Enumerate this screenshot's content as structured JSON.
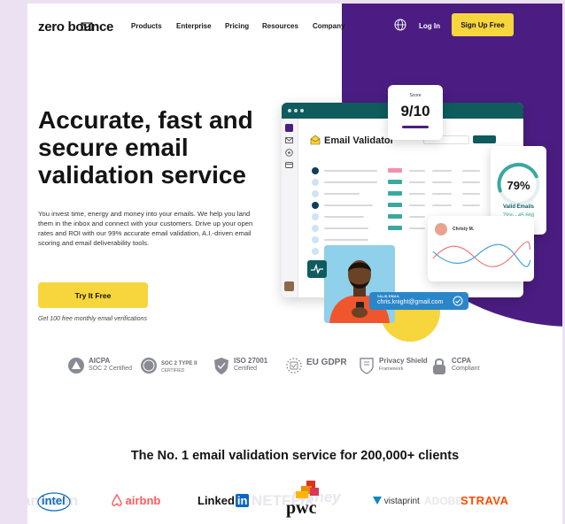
{
  "nav": {
    "logo": "zero bounce",
    "links": [
      "Products",
      "Enterprise",
      "Pricing",
      "Resources",
      "Company"
    ],
    "login": "Log In",
    "signup": "Sign Up Free"
  },
  "hero": {
    "headline": "Accurate, fast and secure email validation service",
    "lead": "You invest time, energy and money into your emails. We help you land them in the inbox and connect with your customers. Drive up your open rates and ROI with our 99% accurate email validation, A.I.-driven email scoring and email deliverability tools.",
    "cta": "Try It Free",
    "cta_note": "Get 100 free monthly email verifications"
  },
  "mock": {
    "title": "Email Validator",
    "score_label": "Score",
    "score_value": "9/10",
    "valid_pct": "79%",
    "valid_pct_value": 79,
    "valid_label": "Valid Emails",
    "valid_count": "79% - 45,668",
    "person_name": "Christy M.",
    "email_label": "VALID EMAIL",
    "email": "chris.knight@gmail.com"
  },
  "certs": [
    {
      "name": "AICPA",
      "sub": "SOC 2 Certified"
    },
    {
      "name": "SOC 2 TYPE II",
      "sub": "CERTIFIED"
    },
    {
      "name": "ISO 27001",
      "sub": "Certified"
    },
    {
      "name": "EU GDPR",
      "sub": ""
    },
    {
      "name": "Privacy Shield",
      "sub": "Framework"
    },
    {
      "name": "CCPA",
      "sub": "Compliant"
    }
  ],
  "clients": {
    "title": "The No. 1 email validation service for 200,000+ clients",
    "logos": [
      "intel",
      "airbnb",
      "Linked",
      "in",
      "pwc",
      "vistaprint",
      "STRAVA"
    ]
  },
  "colors": {
    "purple": "#4b1d82",
    "yellow": "#f7d53c",
    "teal": "#0f5b5d",
    "blue": "#2a86c9"
  }
}
